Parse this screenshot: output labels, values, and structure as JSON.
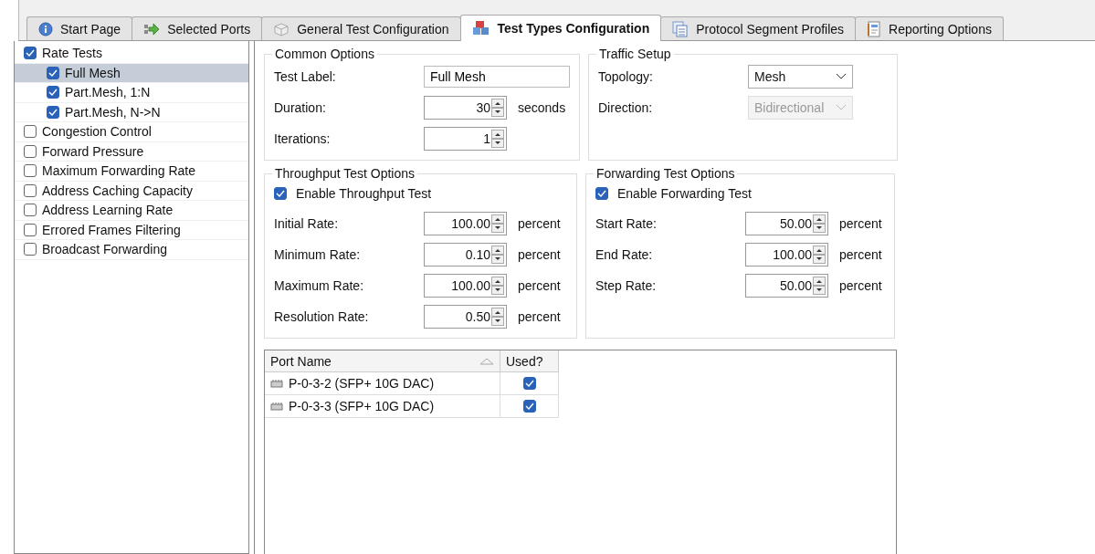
{
  "tabs": [
    {
      "label": "Start Page",
      "selected": false
    },
    {
      "label": "Selected Ports",
      "selected": false
    },
    {
      "label": "General Test Configuration",
      "selected": false
    },
    {
      "label": "Test Types Configuration",
      "selected": true
    },
    {
      "label": "Protocol Segment Profiles",
      "selected": false
    },
    {
      "label": "Reporting Options",
      "selected": false
    }
  ],
  "test_tree": [
    {
      "label": "Rate Tests",
      "checked": true,
      "selected": false,
      "children": [
        {
          "label": "Full Mesh",
          "checked": true,
          "selected": true
        },
        {
          "label": "Part.Mesh, 1:N",
          "checked": true,
          "selected": false
        },
        {
          "label": "Part.Mesh, N->N",
          "checked": true,
          "selected": false
        }
      ]
    },
    {
      "label": "Congestion Control",
      "checked": false,
      "selected": false
    },
    {
      "label": "Forward Pressure",
      "checked": false,
      "selected": false
    },
    {
      "label": "Maximum Forwarding Rate",
      "checked": false,
      "selected": false
    },
    {
      "label": "Address Caching Capacity",
      "checked": false,
      "selected": false
    },
    {
      "label": "Address Learning Rate",
      "checked": false,
      "selected": false
    },
    {
      "label": "Errored Frames Filtering",
      "checked": false,
      "selected": false
    },
    {
      "label": "Broadcast Forwarding",
      "checked": false,
      "selected": false
    }
  ],
  "common_options": {
    "title": "Common Options",
    "fields": [
      {
        "kind": "text",
        "label": "Test Label:",
        "value": "Full Mesh"
      },
      {
        "kind": "spin",
        "label": "Duration:",
        "value": "30",
        "unit": "seconds"
      },
      {
        "kind": "spin",
        "label": "Iterations:",
        "value": "1"
      }
    ]
  },
  "traffic_setup": {
    "title": "Traffic Setup",
    "fields": [
      {
        "kind": "dropdown",
        "label": "Topology:",
        "value": "Mesh",
        "disabled": false
      },
      {
        "kind": "dropdown",
        "label": "Direction:",
        "value": "Bidirectional",
        "disabled": true
      }
    ]
  },
  "throughput_test_options": {
    "title": "Throughput Test Options",
    "enable": {
      "label": "Enable Throughput Test",
      "checked": true
    },
    "fields": [
      {
        "kind": "spin",
        "label": "Initial Rate:",
        "value": "100.00",
        "unit": "percent"
      },
      {
        "kind": "spin",
        "label": "Minimum Rate:",
        "value": "0.10",
        "unit": "percent"
      },
      {
        "kind": "spin",
        "label": "Maximum Rate:",
        "value": "100.00",
        "unit": "percent"
      },
      {
        "kind": "spin",
        "label": "Resolution Rate:",
        "value": "0.50",
        "unit": "percent"
      }
    ]
  },
  "forwarding_test_options": {
    "title": "Forwarding Test Options",
    "enable": {
      "label": "Enable Forwarding Test",
      "checked": true
    },
    "fields": [
      {
        "kind": "spin",
        "label": "Start Rate:",
        "value": "50.00",
        "unit": "percent"
      },
      {
        "kind": "spin",
        "label": "End Rate:",
        "value": "100.00",
        "unit": "percent"
      },
      {
        "kind": "spin",
        "label": "Step Rate:",
        "value": "50.00",
        "unit": "percent"
      }
    ]
  },
  "port_table": {
    "columns": [
      {
        "label": "Port Name",
        "sorted": true
      },
      {
        "label": "Used?",
        "sorted": false
      }
    ],
    "rows": [
      {
        "name": "P-0-3-2 (SFP+ 10G DAC)",
        "used": true
      },
      {
        "name": "P-0-3-3 (SFP+ 10G DAC)",
        "used": true
      }
    ]
  }
}
